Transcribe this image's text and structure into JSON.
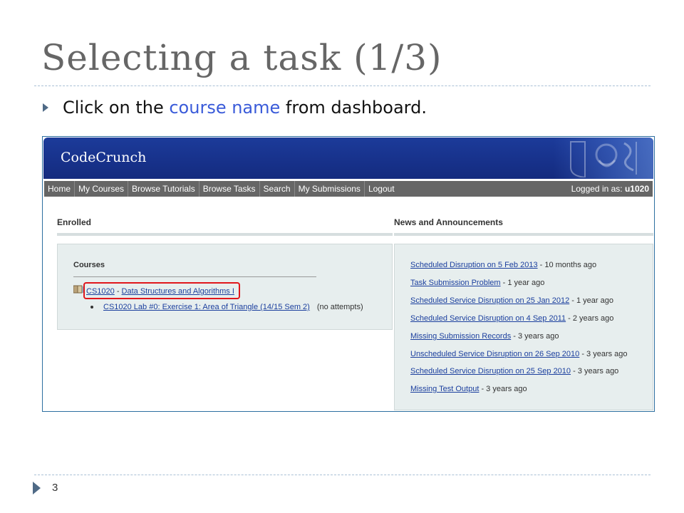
{
  "slide": {
    "title": "Selecting a task (1/3)",
    "bullet_before": "Click on the ",
    "bullet_highlight": "course name",
    "bullet_after": " from dashboard.",
    "page_number": "3",
    "colors": {
      "title": "#666666",
      "highlight": "#3a5bd9",
      "red_box": "#e0161c"
    }
  },
  "app": {
    "logo": "CodeCrunch",
    "nav": {
      "items": [
        "Home",
        "My Courses",
        "Browse Tutorials",
        "Browse Tasks",
        "Search",
        "My Submissions",
        "Logout"
      ],
      "logged_in_label": "Logged in as: ",
      "username": "u1020"
    },
    "enrolled": {
      "title": "Enrolled",
      "courses_title": "Courses",
      "course_code": "CS1020",
      "course_sep": " - ",
      "course_name": "Data Structures and Algorithms I",
      "task_link": "CS1020 Lab #0: Exercise 1: Area of Triangle (14/15 Sem 2)",
      "task_status": "(no attempts)"
    },
    "news": {
      "title": "News and Announcements",
      "items": [
        {
          "link": "Scheduled Disruption on 5 Feb 2013",
          "age": " - 10 months ago"
        },
        {
          "link": "Task Submission Problem",
          "age": " - 1 year ago"
        },
        {
          "link": "Scheduled Service Disruption on 25 Jan 2012",
          "age": " - 1 year ago"
        },
        {
          "link": "Scheduled Service Disruption on 4 Sep 2011",
          "age": " - 2 years ago"
        },
        {
          "link": "Missing Submission Records",
          "age": " - 3 years ago"
        },
        {
          "link": "Unscheduled Service Disruption on 26 Sep 2010",
          "age": " - 3 years ago"
        },
        {
          "link": "Scheduled Service Disruption on 25 Sep 2010",
          "age": " - 3 years ago"
        },
        {
          "link": "Missing Test Output",
          "age": " - 3 years ago"
        }
      ]
    }
  }
}
